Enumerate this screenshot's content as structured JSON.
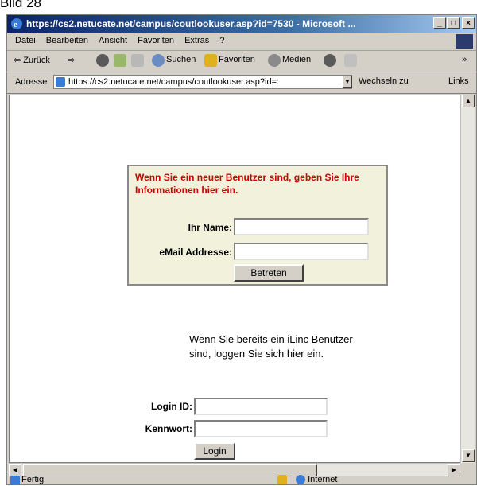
{
  "caption": "Bild 28",
  "window": {
    "title": "https://cs2.netucate.net/campus/coutlookuser.asp?id=7530 - Microsoft ...",
    "controls": [
      "_",
      "□",
      "×"
    ]
  },
  "menu": [
    "Datei",
    "Bearbeiten",
    "Ansicht",
    "Favoriten",
    "Extras",
    "?"
  ],
  "toolbar": {
    "back": "⇦ Zurück",
    "forward": "⇨",
    "search": "Suchen",
    "favorites": "Favoriten",
    "media": "Medien",
    "more": "»"
  },
  "address": {
    "label": "Adresse",
    "url": "https://cs2.netucate.net/campus/coutlookuser.asp?id=:",
    "go": "Wechseln zu",
    "links": "Links"
  },
  "guest_form": {
    "message": "Wenn Sie ein neuer Benutzer sind, geben Sie Ihre Informationen hier ein.",
    "name_label": "Ihr Name:",
    "name_value": "",
    "email_label": "eMail Addresse:",
    "email_value": "",
    "submit": "Betreten"
  },
  "member_form": {
    "message": "Wenn Sie bereits ein iLinc Benutzer sind, loggen Sie sich hier ein.",
    "login_label": "Login ID:",
    "login_value": "",
    "password_label": "Kennwort:",
    "password_value": "",
    "submit": "Login"
  },
  "status": {
    "text": "Fertig",
    "zone": "Internet"
  }
}
